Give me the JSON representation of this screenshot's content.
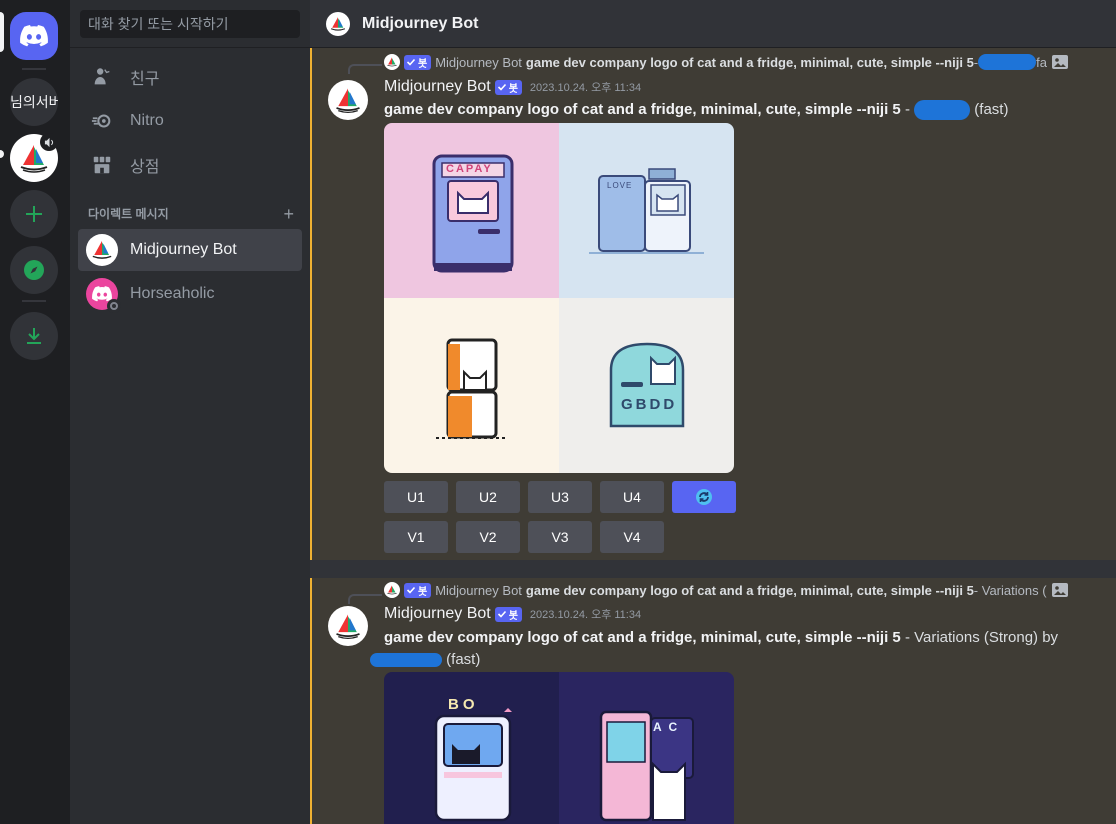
{
  "rail": {
    "server_text": "님의서버",
    "colors": {
      "home": "#5865f2",
      "add": "#23a559"
    }
  },
  "sidebar": {
    "search_placeholder": "대화 찾기 또는 시작하기",
    "nav": [
      {
        "label": "친구",
        "icon": "friends-icon"
      },
      {
        "label": "Nitro",
        "icon": "nitro-icon"
      },
      {
        "label": "상점",
        "icon": "shop-icon"
      }
    ],
    "dm_header": "다이렉트 메시지",
    "dm_add": "+",
    "dms": [
      {
        "name": "Midjourney Bot"
      },
      {
        "name": "Horseaholic"
      }
    ]
  },
  "channel": {
    "title": "Midjourney Bot"
  },
  "messages": [
    {
      "reply": {
        "badge": "봇",
        "author": "Midjourney Bot",
        "text": "game dev company logo of cat and a fridge, minimal, cute, simple --niji 5",
        "suffix": " - ",
        "suffix2": "fa"
      },
      "author": "Midjourney Bot",
      "badge": "봇",
      "timestamp": "2023.10.24. 오후 11:34",
      "prompt": "game dev company logo of cat and a fridge, minimal, cute, simple --niji 5",
      "tail_before": " - ",
      "tail_after": " (fast)",
      "images": [
        "CAPAY",
        "LOVE",
        "",
        "GBDD"
      ],
      "upscale_buttons": [
        "U1",
        "U2",
        "U3",
        "U4"
      ],
      "variation_buttons": [
        "V1",
        "V2",
        "V3",
        "V4"
      ],
      "reroll_icon": "reroll-icon"
    },
    {
      "reply": {
        "badge": "봇",
        "author": "Midjourney Bot",
        "text": "game dev company logo of cat and a fridge, minimal, cute, simple --niji 5",
        "suffix": " - Variations ("
      },
      "author": "Midjourney Bot",
      "badge": "봇",
      "timestamp": "2023.10.24. 오후 11:34",
      "prompt": "game dev company logo of cat and a fridge, minimal, cute, simple --niji 5",
      "tail_before": " - Variations (Strong) by",
      "tail_after": " (fast)",
      "images": [
        "BO",
        "A C"
      ]
    }
  ]
}
